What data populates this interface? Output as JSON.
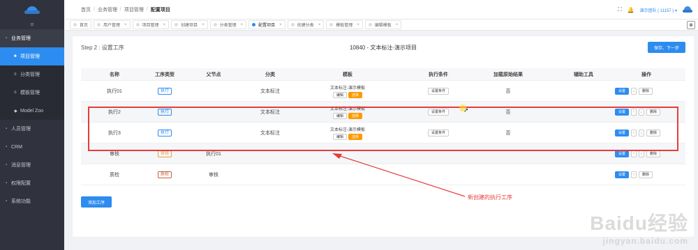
{
  "sidebar": {
    "hamburger": "≡",
    "groups": [
      {
        "label": "业务管理",
        "icon": "▪"
      },
      {
        "label": "人员管理",
        "icon": "▪"
      },
      {
        "label": "CRM",
        "icon": "▪"
      },
      {
        "label": "消息管理",
        "icon": "▪"
      },
      {
        "label": "权限配置",
        "icon": "▪"
      },
      {
        "label": "系统功能",
        "icon": "▪"
      }
    ],
    "sub_items": [
      {
        "label": "项目管理",
        "icon": "■"
      },
      {
        "label": "分类管理",
        "icon": "≡"
      },
      {
        "label": "模板管理",
        "icon": "≡"
      },
      {
        "label": "Model Zoo",
        "icon": "◆"
      }
    ]
  },
  "header": {
    "breadcrumb": [
      "首页",
      "业务管理",
      "项目管理",
      "配置项目"
    ],
    "separator": "/",
    "fullscreen_icon": "⛶",
    "bell_icon": "🔔",
    "user_label": "演示团队 ( 11157 ) ▾"
  },
  "tabs": [
    {
      "label": "首页",
      "close": ""
    },
    {
      "label": "用户管理",
      "close": "×"
    },
    {
      "label": "项目管理",
      "close": "×"
    },
    {
      "label": "创建项目",
      "close": "×"
    },
    {
      "label": "分类管理",
      "close": "×"
    },
    {
      "label": "配置项目",
      "close": "×"
    },
    {
      "label": "创建分类",
      "close": "×"
    },
    {
      "label": "模板管理",
      "close": "×"
    },
    {
      "label": "编辑模板",
      "close": "×"
    }
  ],
  "tabs_close_all": "⊗",
  "panel": {
    "step_title": "Step 2 : 设置工序",
    "project_title": "10840 - 文本标注-演示项目",
    "save_next_label": "保存、下一步",
    "add_step_label": "添加工序"
  },
  "table": {
    "columns": [
      "名称",
      "工序类型",
      "父节点",
      "分类",
      "模板",
      "执行条件",
      "加载原始结果",
      "辅助工具",
      "操作"
    ],
    "rows": [
      {
        "name": "执行01",
        "type": "执行",
        "type_color": "blue",
        "parent": "",
        "category": "文本标注",
        "template": "文本标注-演示模板",
        "edit": "编辑",
        "select": "选择",
        "condition": "设置条件",
        "load_raw": "否",
        "set": "设置",
        "up": "",
        "down": "↓",
        "delete": "删除"
      },
      {
        "name": "执行2",
        "type": "执行",
        "type_color": "blue",
        "parent": "",
        "category": "文本标注",
        "template": "文本标注-演示模板",
        "edit": "编辑",
        "select": "选择",
        "condition": "设置条件",
        "load_raw": "否",
        "set": "设置",
        "up": "↑",
        "down": "↓",
        "delete": "删除"
      },
      {
        "name": "执行3",
        "type": "执行",
        "type_color": "blue",
        "parent": "",
        "category": "文本标注",
        "template": "文本标注-演示模板",
        "edit": "编辑",
        "select": "选择",
        "condition": "设置条件",
        "load_raw": "否",
        "set": "设置",
        "up": "↑",
        "down": "↓",
        "delete": "删除"
      },
      {
        "name": "审核",
        "type": "审核",
        "type_color": "orange",
        "parent": "执行01",
        "category": "",
        "template": "",
        "edit": "",
        "select": "",
        "condition": "",
        "load_raw": "",
        "set": "设置",
        "up": "↑",
        "down": "↓",
        "delete": "删除"
      },
      {
        "name": "质检",
        "type": "质检",
        "type_color": "brown",
        "parent": "审核",
        "category": "",
        "template": "",
        "edit": "",
        "select": "",
        "condition": "",
        "load_raw": "",
        "set": "设置",
        "up": "↑",
        "down": "",
        "delete": "删除"
      }
    ]
  },
  "annotation": {
    "text": "新创建的执行工序",
    "color": "#e63b3b"
  },
  "watermark": {
    "main": "Baidu经验",
    "sub": "jingyan.baidu.com"
  },
  "colors": {
    "primary": "#2d8cf0",
    "sidebar_bg": "#30333d",
    "orange": "#ff9900",
    "annotation_red": "#e63b3b"
  }
}
